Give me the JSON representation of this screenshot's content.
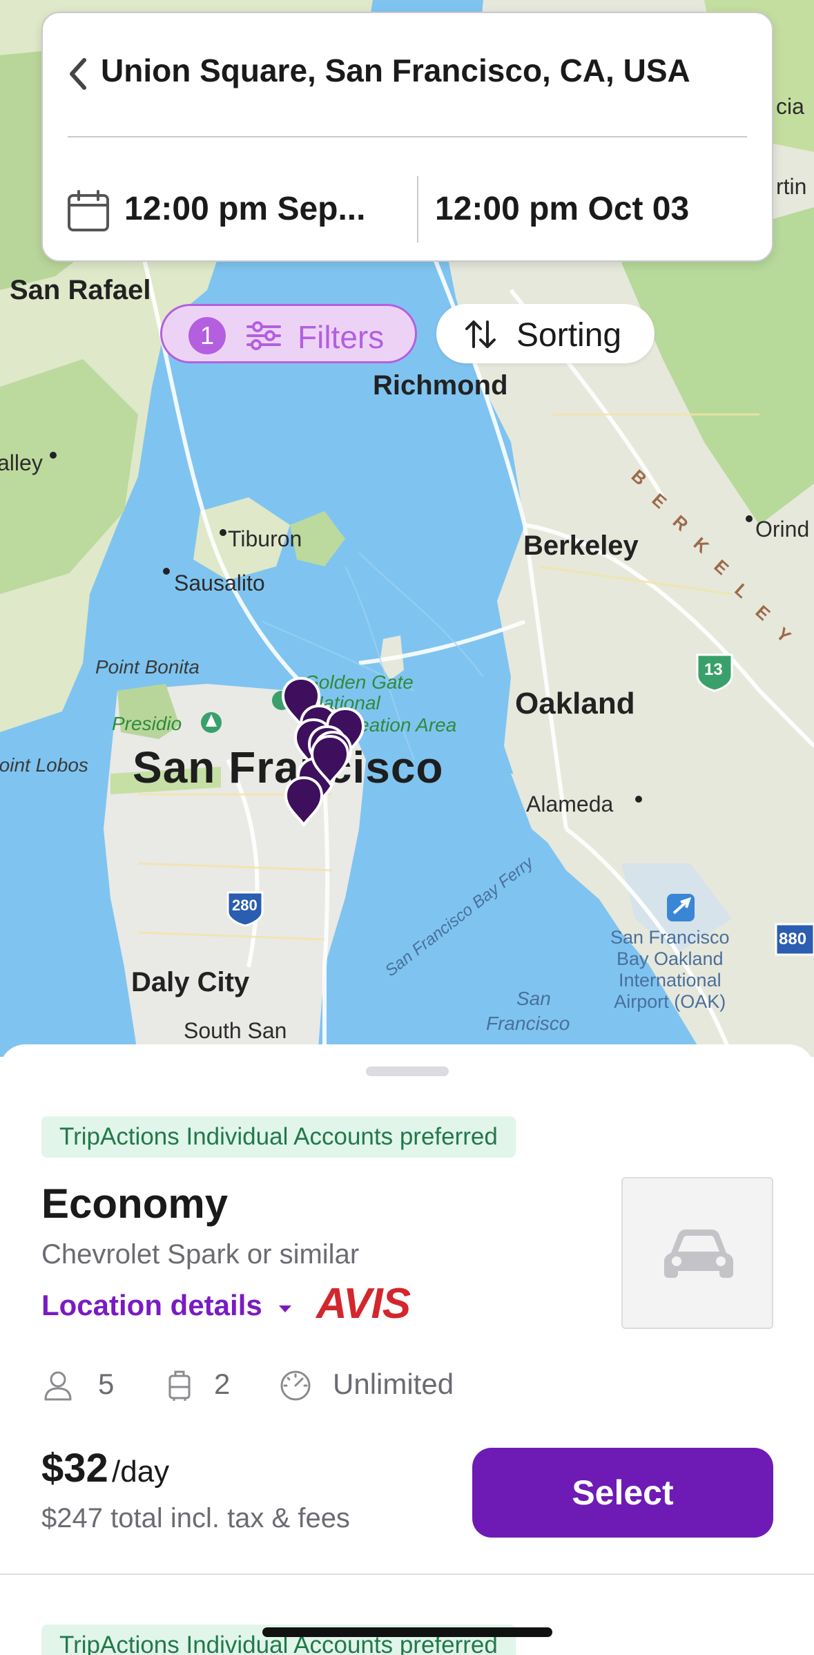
{
  "search": {
    "location": "Union Square, San Francisco, CA, USA",
    "pickup": "12:00 pm Sep...",
    "dropoff": "12:00 pm Oct 03"
  },
  "toolbar": {
    "filters_count": "1",
    "filters_label": "Filters",
    "sorting_label": "Sorting"
  },
  "map": {
    "labels": {
      "san_rafael": "San Rafael",
      "richmond": "Richmond",
      "berkeley": "Berkeley",
      "tiburon": "Tiburon",
      "sausalito": "Sausalito",
      "point_bonita": "Point Bonita",
      "golden_gate_1": "Golden Gate",
      "golden_gate_2": "National",
      "golden_gate_3": "Recreation Area",
      "presidio": "Presidio",
      "point_lobos": "Point Lobos",
      "san_francisco": "San Francisco",
      "oakland": "Oakland",
      "alameda": "Alameda",
      "daly_city": "Daly City",
      "south_san": "South San",
      "bay_ferry": "San Francisco Bay Ferry",
      "sf_water_1": "San",
      "sf_water_2": "Francisco",
      "airport_1": "San Francisco",
      "airport_2": "Bay Oakland",
      "airport_3": "International",
      "airport_4": "Airport (OAK)",
      "orinda": "Orind",
      "valley": "alley",
      "cia": "cia",
      "rtin": "rtin",
      "route_13": "13",
      "route_280": "280",
      "route_880": "880",
      "berkeley_hills": [
        "B",
        "E",
        "R",
        "K",
        "E",
        "L",
        "E",
        "Y"
      ]
    },
    "colors": {
      "water": "#7fc4f0",
      "land": "#e8ecd9",
      "park": "#b7d99a",
      "pin": "#3d0f5c"
    }
  },
  "result": {
    "preferred_badge": "TripActions Individual Accounts preferred",
    "car_class": "Economy",
    "car_model": "Chevrolet Spark or similar",
    "location_details": "Location details",
    "vendor": "AVIS",
    "passengers": "5",
    "bags": "2",
    "mileage": "Unlimited",
    "price_per_day": "$32",
    "per_day_suffix": "/day",
    "total_price": "$247 total incl. tax & fees",
    "select_label": "Select",
    "car_image_icon": "car-icon"
  },
  "result_next": {
    "preferred_badge": "TripActions Individual Accounts preferred"
  },
  "accent_color": "#6e1bb5"
}
